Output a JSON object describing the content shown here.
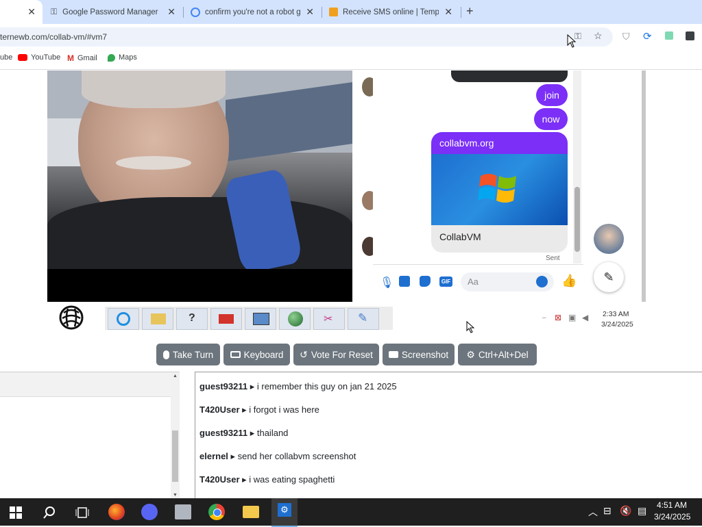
{
  "browser": {
    "tabs": [
      {
        "title": "",
        "active": true
      },
      {
        "title": "Google Password Manager"
      },
      {
        "title": "confirm you're not a robot goo"
      },
      {
        "title": "Receive SMS online | Temporar"
      }
    ],
    "new_tab": "+",
    "url": "ternewb.com/collab-vm/#vm7",
    "bookmarks": [
      {
        "label": "ube"
      },
      {
        "label": "YouTube"
      },
      {
        "label": "Gmail"
      },
      {
        "label": "Maps"
      }
    ]
  },
  "vm_screen": {
    "messenger": {
      "bubbles": [
        "join",
        "now"
      ],
      "link_card": {
        "domain": "collabvm.org",
        "title": "CollabVM"
      },
      "status": "Sent",
      "input_placeholder": "Aa",
      "gif_label": "GIF"
    },
    "tray": {
      "time": "2:33 AM",
      "date": "3/24/2025"
    }
  },
  "controls": {
    "take_turn": "Take Turn",
    "keyboard": "Keyboard",
    "vote_reset": "Vote For Reset",
    "screenshot": "Screenshot",
    "ctrl_alt_del": "Ctrl+Alt+Del"
  },
  "chat": {
    "messages": [
      {
        "user": "guest93211",
        "text": "i remember this guy on jan 21 2025"
      },
      {
        "user": "T420User",
        "text": "i forgot i was here"
      },
      {
        "user": "guest93211",
        "text": "thailand"
      },
      {
        "user": "elernel",
        "text": "send her collabvm screenshot"
      },
      {
        "user": "T420User",
        "text": "i was eating spaghetti"
      }
    ]
  },
  "taskbar": {
    "time": "4:51 AM",
    "date": "3/24/2025"
  },
  "colors": {
    "tabstrip": "#d3e3fd",
    "messenger_bubble": "#7b2ff7",
    "button": "#6c757d",
    "vm_selection": "#b57ee0"
  }
}
